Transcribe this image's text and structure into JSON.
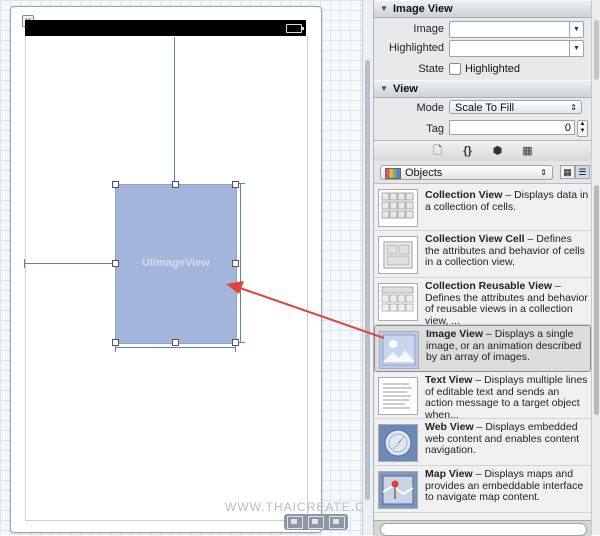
{
  "canvas": {
    "image_view_label": "UIImageView",
    "watermark": "WWW.THAICREATE.COM",
    "close_glyph": "✕"
  },
  "inspector": {
    "image_view_section": {
      "title": "Image View",
      "image_label": "Image",
      "image_value": "",
      "highlighted_label": "Highlighted",
      "highlighted_value": "",
      "state_label": "State",
      "state_checkbox_label": "Highlighted",
      "state_checked": false
    },
    "view_section": {
      "title": "View",
      "mode_label": "Mode",
      "mode_value": "Scale To Fill",
      "tag_label": "Tag",
      "tag_value": "0"
    },
    "library_tabs": [
      {
        "icon": "file-template-icon",
        "glyph": "🗋"
      },
      {
        "icon": "code-snippet-icon",
        "glyph": "{}"
      },
      {
        "icon": "object-library-icon",
        "glyph": "⬢"
      },
      {
        "icon": "media-library-icon",
        "glyph": "▦"
      }
    ],
    "library": {
      "filter_value": "Objects",
      "items": [
        {
          "title": "Collection View",
          "desc": " – Displays data in a collection of cells.",
          "icon": "collection-view-icon"
        },
        {
          "title": "Collection View Cell",
          "desc": " – Defines the attributes and behavior of cells in a collection view.",
          "icon": "collection-view-cell-icon"
        },
        {
          "title": "Collection Reusable View",
          "desc": " – Defines the attributes and behavior of reusable views in a collection view, ...",
          "icon": "collection-reusable-view-icon"
        },
        {
          "title": "Image View",
          "desc": " – Displays a single image, or an animation described by an array of images.",
          "icon": "image-view-icon"
        },
        {
          "title": "Text View",
          "desc": " – Displays multiple lines of editable text and sends an action message to a target object when...",
          "icon": "text-view-icon"
        },
        {
          "title": "Web View",
          "desc": " – Displays embedded web content and enables content navigation.",
          "icon": "web-view-icon"
        },
        {
          "title": "Map View",
          "desc": " – Displays maps and provides an embeddable interface to navigate map content.",
          "icon": "map-view-icon"
        }
      ]
    }
  },
  "colors": {
    "image_view_fill": "#a3b5dd",
    "arrow": "#e0443a",
    "selection_bg": "#dcdcdc"
  }
}
